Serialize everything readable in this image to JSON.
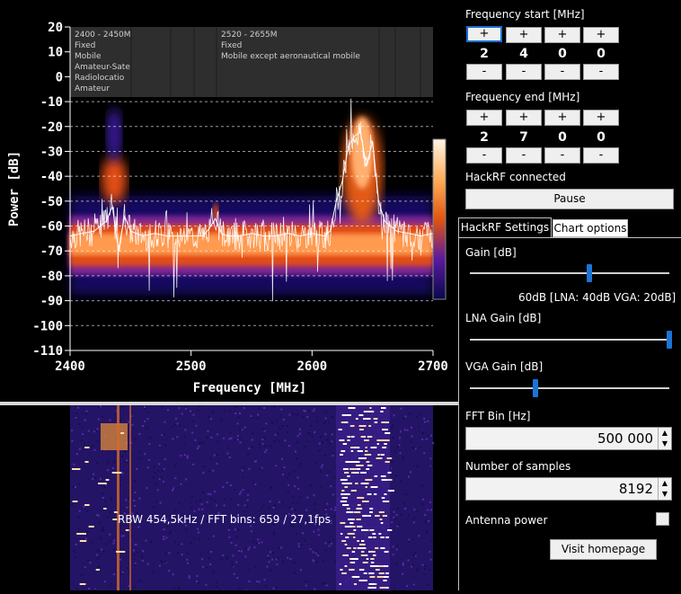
{
  "spectrum": {
    "y_axis_label": "Power [dB]",
    "x_axis_label": "Frequency [MHz]",
    "y_ticks": [
      "20",
      "10",
      "0",
      "-10",
      "-20",
      "-30",
      "-40",
      "-50",
      "-60",
      "-70",
      "-80",
      "-90",
      "-100",
      "-110"
    ],
    "x_ticks": [
      "2400",
      "2500",
      "2600",
      "2700"
    ],
    "band1": {
      "range": "2400 - 2450M",
      "services": [
        "Fixed",
        "Mobile",
        "Amateur-Sate",
        "Radiolocatio",
        "Amateur"
      ]
    },
    "band2": {
      "range": "2520 - 2655M",
      "services": [
        "Fixed",
        "Mobile except aeronautical mobile"
      ]
    }
  },
  "chart_data": {
    "type": "line",
    "xlabel": "Frequency [MHz]",
    "ylabel": "Power [dB]",
    "xlim": [
      2400,
      2700
    ],
    "ylim": [
      -110,
      20
    ],
    "grid": true,
    "series": [
      {
        "x": [
          2400,
          2410,
          2420,
          2425,
          2430,
          2435,
          2440,
          2445,
          2450,
          2460,
          2470,
          2480,
          2490,
          2500,
          2510,
          2515,
          2520,
          2525,
          2530,
          2540,
          2550,
          2560,
          2570,
          2580,
          2590,
          2600,
          2610,
          2615,
          2620,
          2625,
          2630,
          2635,
          2640,
          2645,
          2650,
          2655,
          2660,
          2670,
          2680,
          2690,
          2700
        ],
        "y": [
          -64,
          -63,
          -62,
          -60,
          -58,
          -52,
          -70,
          -56,
          -62,
          -64,
          -63,
          -64,
          -64,
          -64,
          -64,
          -61,
          -57,
          -63,
          -64,
          -64,
          -63,
          -64,
          -64,
          -63,
          -64,
          -63,
          -64,
          -62,
          -50,
          -42,
          -28,
          -24,
          -22,
          -36,
          -26,
          -50,
          -58,
          -62,
          -63,
          -64,
          -63
        ]
      }
    ]
  },
  "waterfall": {
    "status": "RBW 454,5kHz / FFT bins: 659 / 27,1fps"
  },
  "controls": {
    "freq_start_label": "Frequency start [MHz]",
    "freq_start_digits": [
      "2",
      "4",
      "0",
      "0"
    ],
    "freq_end_label": "Frequency end [MHz]",
    "freq_end_digits": [
      "2",
      "7",
      "0",
      "0"
    ],
    "plus": "+",
    "minus": "-",
    "status": "HackRF connected",
    "pause_label": "Pause",
    "tabs": [
      "HackRF Settings",
      "Chart options"
    ],
    "gain_label": "Gain [dB]",
    "gain_fraction": 0.6,
    "gain_readout": "60dB  [LNA: 40dB  VGA: 20dB]",
    "lna_label": "LNA Gain [dB]",
    "lna_fraction": 1.0,
    "vga_label": "VGA Gain [dB]",
    "vga_fraction": 0.33,
    "fft_label": "FFT Bin [Hz]",
    "fft_value": "500 000",
    "samples_label": "Number of samples",
    "samples_value": "8192",
    "antenna_label": "Antenna power",
    "antenna_checked": false,
    "homepage_label": "Visit homepage"
  }
}
